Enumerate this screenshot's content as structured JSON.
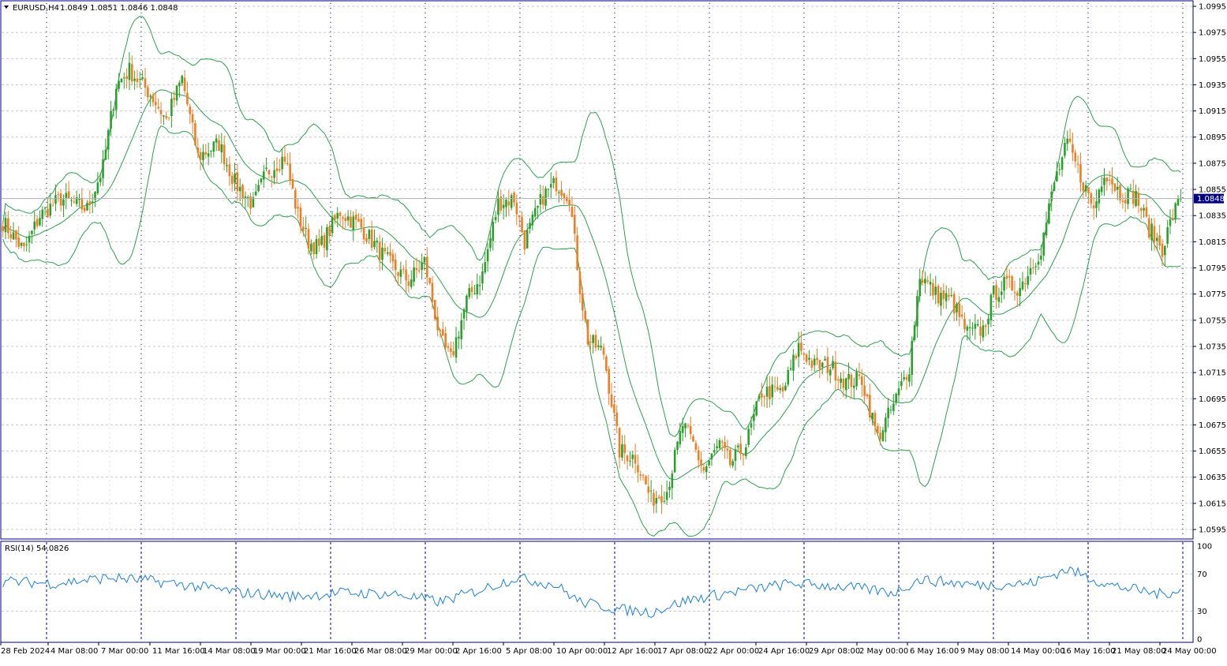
{
  "header": {
    "symbol": "EURUSD,H4",
    "ohlc": "1.0849 1.0851 1.0846 1.0848",
    "arrow_icon": "triangle-down-icon"
  },
  "main_chart": {
    "current_price": "1.0848",
    "price_ticks": [
      "1.0995",
      "1.0975",
      "1.0955",
      "1.0935",
      "1.0915",
      "1.0895",
      "1.0875",
      "1.0855",
      "1.0835",
      "1.0815",
      "1.0795",
      "1.0775",
      "1.0755",
      "1.0735",
      "1.0715",
      "1.0695",
      "1.0675",
      "1.0655",
      "1.0635",
      "1.0615",
      "1.0595"
    ],
    "colors": {
      "bull": "#2ca02c",
      "bear": "#f07d22",
      "bands": "#2e9e4f",
      "grid": "#c8c8c8",
      "axis": "#000080",
      "current_price_bg": "#000080"
    }
  },
  "rsi_panel": {
    "label": "RSI(14) 54.0826",
    "ticks": [
      "100",
      "70",
      "30",
      "0"
    ],
    "line_color": "#1e7fd6"
  },
  "time_axis": {
    "labels": [
      "28 Feb 2024",
      "4 Mar 08:00",
      "7 Mar 00:00",
      "11 Mar 16:00",
      "14 Mar 08:00",
      "19 Mar 00:00",
      "21 Mar 16:00",
      "26 Mar 08:00",
      "29 Mar 00:00",
      "2 Apr 16:00",
      "5 Apr 08:00",
      "10 Apr 00:00",
      "12 Apr 16:00",
      "17 Apr 08:00",
      "22 Apr 00:00",
      "24 Apr 16:00",
      "29 Apr 08:00",
      "2 May 00:00",
      "6 May 16:00",
      "9 May 08:00",
      "14 May 00:00",
      "16 May 16:00",
      "21 May 08:00",
      "24 May 00:00"
    ]
  },
  "chart_data": {
    "type": "candlestick",
    "title": "EURUSD,H4",
    "ylim": [
      1.0589,
      1.0998
    ],
    "rsi_ylim": [
      0,
      100
    ],
    "close_anchors": [
      [
        0,
        1.083
      ],
      [
        8,
        1.0808
      ],
      [
        14,
        1.0835
      ],
      [
        22,
        1.0848
      ],
      [
        32,
        1.084
      ],
      [
        38,
        1.0872
      ],
      [
        43,
        1.0935
      ],
      [
        48,
        1.0946
      ],
      [
        56,
        1.0928
      ],
      [
        62,
        1.0908
      ],
      [
        68,
        1.094
      ],
      [
        74,
        1.088
      ],
      [
        82,
        1.089
      ],
      [
        88,
        1.086
      ],
      [
        95,
        1.0843
      ],
      [
        100,
        1.0868
      ],
      [
        107,
        1.088
      ],
      [
        112,
        1.0835
      ],
      [
        116,
        1.0815
      ],
      [
        120,
        1.081
      ],
      [
        128,
        1.0838
      ],
      [
        136,
        1.0826
      ],
      [
        146,
        1.08
      ],
      [
        154,
        1.0785
      ],
      [
        160,
        1.08
      ],
      [
        166,
        1.074
      ],
      [
        170,
        1.0725
      ],
      [
        176,
        1.077
      ],
      [
        182,
        1.079
      ],
      [
        188,
        1.0845
      ],
      [
        194,
        1.0848
      ],
      [
        198,
        1.0815
      ],
      [
        205,
        1.085
      ],
      [
        210,
        1.086
      ],
      [
        215,
        1.085
      ],
      [
        219,
        1.078
      ],
      [
        222,
        1.074
      ],
      [
        228,
        1.073
      ],
      [
        234,
        1.0655
      ],
      [
        240,
        1.065
      ],
      [
        246,
        1.0618
      ],
      [
        252,
        1.0625
      ],
      [
        258,
        1.0675
      ],
      [
        262,
        1.066
      ],
      [
        266,
        1.064
      ],
      [
        272,
        1.066
      ],
      [
        276,
        1.0645
      ],
      [
        282,
        1.066
      ],
      [
        288,
        1.07
      ],
      [
        296,
        1.07
      ],
      [
        302,
        1.0735
      ],
      [
        308,
        1.072
      ],
      [
        314,
        1.072
      ],
      [
        320,
        1.0708
      ],
      [
        326,
        1.071
      ],
      [
        332,
        1.0665
      ],
      [
        338,
        1.069
      ],
      [
        344,
        1.072
      ],
      [
        348,
        1.079
      ],
      [
        354,
        1.0775
      ],
      [
        360,
        1.077
      ],
      [
        366,
        1.0745
      ],
      [
        372,
        1.0748
      ],
      [
        376,
        1.0775
      ],
      [
        380,
        1.0782
      ],
      [
        386,
        1.078
      ],
      [
        390,
        1.0795
      ],
      [
        394,
        1.081
      ],
      [
        399,
        1.086
      ],
      [
        404,
        1.089
      ],
      [
        410,
        1.086
      ],
      [
        414,
        1.084
      ],
      [
        418,
        1.087
      ],
      [
        424,
        1.0852
      ],
      [
        430,
        1.085
      ],
      [
        435,
        1.0825
      ],
      [
        440,
        1.081
      ],
      [
        444,
        1.0835
      ],
      [
        447,
        1.0848
      ]
    ],
    "rsi_anchors": [
      [
        0,
        62
      ],
      [
        20,
        60
      ],
      [
        40,
        66
      ],
      [
        55,
        63
      ],
      [
        70,
        58
      ],
      [
        90,
        50
      ],
      [
        110,
        46
      ],
      [
        130,
        50
      ],
      [
        150,
        48
      ],
      [
        166,
        40
      ],
      [
        180,
        52
      ],
      [
        195,
        66
      ],
      [
        210,
        58
      ],
      [
        219,
        40
      ],
      [
        234,
        32
      ],
      [
        246,
        29
      ],
      [
        260,
        42
      ],
      [
        280,
        52
      ],
      [
        300,
        60
      ],
      [
        320,
        56
      ],
      [
        338,
        50
      ],
      [
        348,
        64
      ],
      [
        370,
        58
      ],
      [
        390,
        60
      ],
      [
        404,
        75
      ],
      [
        420,
        58
      ],
      [
        440,
        48
      ],
      [
        447,
        54.08
      ]
    ],
    "vgrid_count": 13,
    "hgrid": "dashed",
    "legend": "none"
  }
}
